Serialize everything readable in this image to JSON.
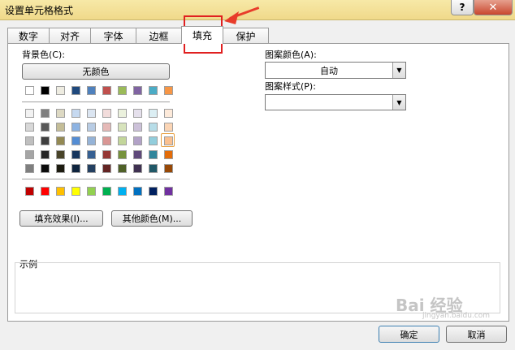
{
  "window": {
    "title": "设置单元格格式",
    "help_label": "?",
    "close_label": "✕"
  },
  "tabs": [
    "数字",
    "对齐",
    "字体",
    "边框",
    "填充",
    "保护"
  ],
  "fill": {
    "background_label": "背景色(C):",
    "no_color_button": "无颜色",
    "fill_effects_button": "填充效果(I)...",
    "more_colors_button": "其他颜色(M)...",
    "pattern_color_label": "图案颜色(A):",
    "pattern_color_value": "自动",
    "pattern_style_label": "图案样式(P):",
    "pattern_style_value": "",
    "sample_label": "示例"
  },
  "palette": {
    "theme_top": [
      "#ffffff",
      "#000000",
      "#eeece1",
      "#1f497d",
      "#4f81bd",
      "#c0504d",
      "#9bbb59",
      "#8064a2",
      "#4bacc6",
      "#f79646"
    ],
    "tints": [
      [
        "#f2f2f2",
        "#7f7f7f",
        "#ddd9c3",
        "#c6d9f0",
        "#dbe5f1",
        "#f2dcdb",
        "#ebf1dd",
        "#e5e0ec",
        "#dbeef3",
        "#fdeada"
      ],
      [
        "#d8d8d8",
        "#595959",
        "#c4bd97",
        "#8db3e2",
        "#b8cce4",
        "#e5b9b7",
        "#d7e3bc",
        "#ccc1d9",
        "#b7dde8",
        "#fbd5b5"
      ],
      [
        "#bfbfbf",
        "#3f3f3f",
        "#938953",
        "#548dd4",
        "#95b3d7",
        "#d99694",
        "#c3d69b",
        "#b2a2c7",
        "#92cddc",
        "#fac08f"
      ],
      [
        "#a5a5a5",
        "#262626",
        "#494429",
        "#17365d",
        "#366092",
        "#953734",
        "#76923c",
        "#5f497a",
        "#31859b",
        "#e36c09"
      ],
      [
        "#7f7f7f",
        "#0c0c0c",
        "#1d1b10",
        "#0f243e",
        "#244061",
        "#632423",
        "#4f6128",
        "#3f3151",
        "#205867",
        "#974806"
      ]
    ],
    "standard": [
      "#c00000",
      "#ff0000",
      "#ffc000",
      "#ffff00",
      "#92d050",
      "#00b050",
      "#00b0f0",
      "#0070c0",
      "#002060",
      "#7030a0"
    ],
    "highlight_color": "#e8a040"
  },
  "footer": {
    "ok_button": "确定",
    "cancel_button": "取消"
  },
  "watermark": {
    "text": "Bai 经验",
    "sub": "jingyan.baidu.com"
  }
}
